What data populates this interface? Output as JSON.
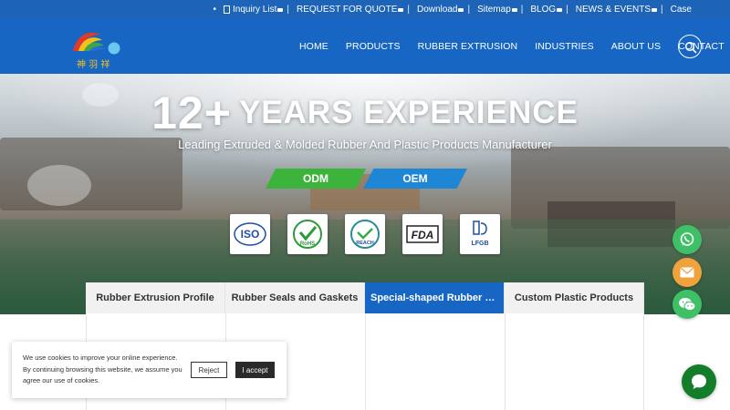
{
  "topbar": {
    "links": [
      {
        "label": "Inquiry List",
        "icon": "document-icon"
      },
      {
        "label": "REQUEST FOR QUOTE"
      },
      {
        "label": "Download"
      },
      {
        "label": "Sitemap"
      },
      {
        "label": "BLOG"
      },
      {
        "label": "NEWS & EVENTS"
      },
      {
        "label": "Case"
      }
    ],
    "separator": "|"
  },
  "nav": {
    "items": [
      "HOME",
      "PRODUCTS",
      "RUBBER EXTRUSION",
      "INDUSTRIES",
      "ABOUT US",
      "CONTACT"
    ],
    "search_icon": "search-icon"
  },
  "hero": {
    "headline_number": "12+",
    "headline_text": "YEARS EXPERIENCE",
    "subtitle": "Leading Extruded & Molded Rubber And Plastic Products Manufacturer",
    "badges": [
      "ODM",
      "OEM"
    ],
    "certifications": [
      {
        "name": "iso-cert-icon",
        "label": "ISO"
      },
      {
        "name": "rohs-cert-icon",
        "label": "RoHS"
      },
      {
        "name": "reach-cert-icon",
        "label": "REACH"
      },
      {
        "name": "fda-cert-icon",
        "label": "FDA"
      },
      {
        "name": "lfgb-cert-icon",
        "label": "LFGB"
      }
    ]
  },
  "tabs": [
    {
      "label": "Rubber Extrusion Profile",
      "active": false
    },
    {
      "label": "Rubber Seals and Gaskets",
      "active": false
    },
    {
      "label": "Special-shaped Rubber Par...",
      "active": true
    },
    {
      "label": "Custom Plastic Products",
      "active": false
    }
  ],
  "cookie": {
    "message": "We use cookies to improve your online experience. By continuing browsing this website, we assume you agree our use of cookies.",
    "reject_label": "Reject",
    "accept_label": "I accept"
  },
  "colors": {
    "primary": "#1766c4",
    "topbar": "#1d63b7",
    "odm": "#3cb43c",
    "oem": "#1f86d6",
    "whatsapp": "#3fc066",
    "mail": "#f0a33a",
    "chat": "#137d29"
  }
}
